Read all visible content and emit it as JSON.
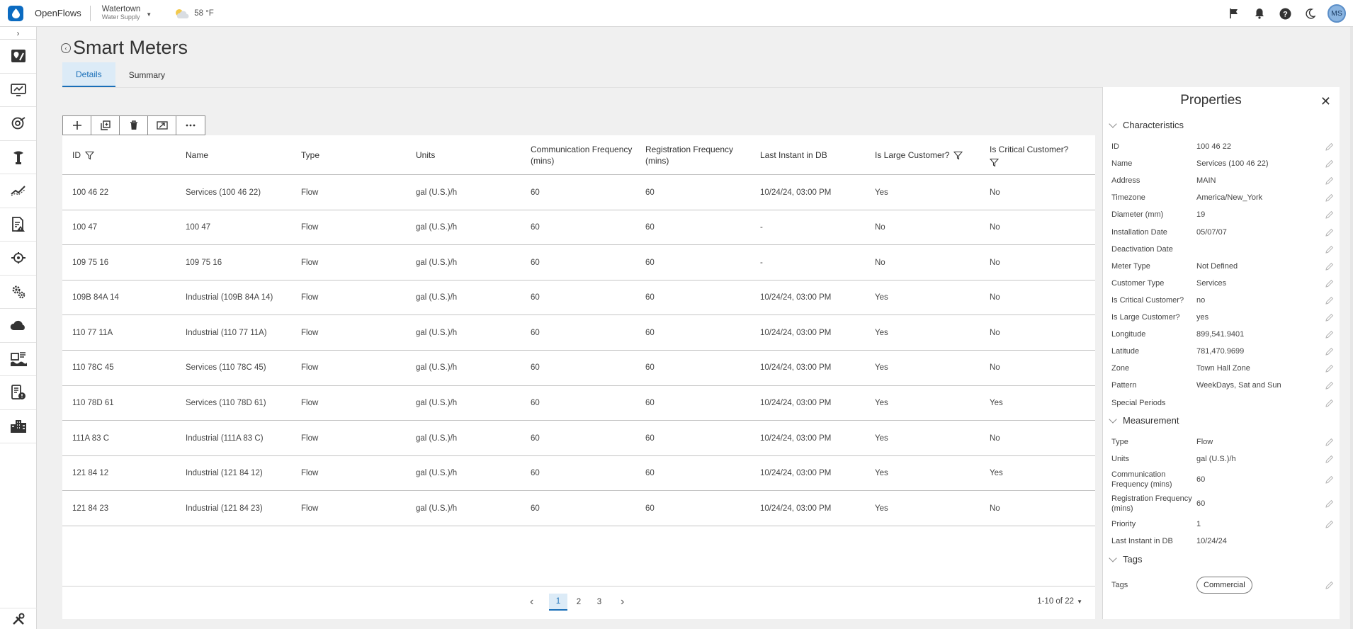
{
  "topbar": {
    "app_name": "OpenFlows",
    "location": "Watertown",
    "location_sub": "Water Supply",
    "weather": "58 °F",
    "user_initials": "MS"
  },
  "page": {
    "title": "Smart Meters",
    "tabs": [
      {
        "label": "Details",
        "active": true
      },
      {
        "label": "Summary",
        "active": false
      }
    ]
  },
  "table": {
    "columns": [
      {
        "label": "ID",
        "filter": true
      },
      {
        "label": "Name",
        "filter": false
      },
      {
        "label": "Type",
        "filter": false
      },
      {
        "label": "Units",
        "filter": false
      },
      {
        "label": "Communication Frequency (mins)",
        "filter": false
      },
      {
        "label": "Registration Frequency (mins)",
        "filter": false
      },
      {
        "label": "Last Instant in DB",
        "filter": false
      },
      {
        "label": "Is Large Customer?",
        "filter": true
      },
      {
        "label": "Is Critical Customer?",
        "filter": true
      }
    ],
    "rows": [
      [
        "100 46 22",
        "Services (100 46 22)",
        "Flow",
        "gal (U.S.)/h",
        "60",
        "60",
        "10/24/24, 03:00 PM",
        "Yes",
        "No"
      ],
      [
        "100 47",
        "100 47",
        "Flow",
        "gal (U.S.)/h",
        "60",
        "60",
        "-",
        "No",
        "No"
      ],
      [
        "109 75 16",
        "109 75 16",
        "Flow",
        "gal (U.S.)/h",
        "60",
        "60",
        "-",
        "No",
        "No"
      ],
      [
        "109B 84A 14",
        "Industrial (109B 84A 14)",
        "Flow",
        "gal (U.S.)/h",
        "60",
        "60",
        "10/24/24, 03:00 PM",
        "Yes",
        "No"
      ],
      [
        "110 77 11A",
        "Industrial (110 77 11A)",
        "Flow",
        "gal (U.S.)/h",
        "60",
        "60",
        "10/24/24, 03:00 PM",
        "Yes",
        "No"
      ],
      [
        "110 78C 45",
        "Services (110 78C 45)",
        "Flow",
        "gal (U.S.)/h",
        "60",
        "60",
        "10/24/24, 03:00 PM",
        "Yes",
        "No"
      ],
      [
        "110 78D 61",
        "Services (110 78D 61)",
        "Flow",
        "gal (U.S.)/h",
        "60",
        "60",
        "10/24/24, 03:00 PM",
        "Yes",
        "Yes"
      ],
      [
        "111A 83 C",
        "Industrial (111A 83 C)",
        "Flow",
        "gal (U.S.)/h",
        "60",
        "60",
        "10/24/24, 03:00 PM",
        "Yes",
        "No"
      ],
      [
        "121 84 12",
        "Industrial (121 84 12)",
        "Flow",
        "gal (U.S.)/h",
        "60",
        "60",
        "10/24/24, 03:00 PM",
        "Yes",
        "Yes"
      ],
      [
        "121 84 23",
        "Industrial (121 84 23)",
        "Flow",
        "gal (U.S.)/h",
        "60",
        "60",
        "10/24/24, 03:00 PM",
        "Yes",
        "No"
      ]
    ]
  },
  "pager": {
    "pages": [
      "1",
      "2",
      "3"
    ],
    "current": "1",
    "range": "1-10 of 22"
  },
  "properties": {
    "title": "Properties",
    "characteristics": {
      "title": "Characteristics",
      "fields": [
        {
          "label": "ID",
          "value": "100 46 22"
        },
        {
          "label": "Name",
          "value": "Services (100 46 22)"
        },
        {
          "label": "Address",
          "value": "MAIN"
        },
        {
          "label": "Timezone",
          "value": "America/New_York"
        },
        {
          "label": "Diameter (mm)",
          "value": "19"
        },
        {
          "label": "Installation Date",
          "value": "05/07/07"
        },
        {
          "label": "Deactivation Date",
          "value": ""
        },
        {
          "label": "Meter Type",
          "value": "Not Defined"
        },
        {
          "label": "Customer Type",
          "value": "Services"
        },
        {
          "label": "Is Critical Customer?",
          "value": "no"
        },
        {
          "label": "Is Large Customer?",
          "value": "yes"
        },
        {
          "label": "Longitude",
          "value": "899,541.9401"
        },
        {
          "label": "Latitude",
          "value": "781,470.9699"
        },
        {
          "label": "Zone",
          "value": "Town Hall Zone"
        },
        {
          "label": "Pattern",
          "value": "WeekDays, Sat and Sun"
        },
        {
          "label": "Special Periods",
          "value": ""
        }
      ]
    },
    "measurement": {
      "title": "Measurement",
      "fields": [
        {
          "label": "Type",
          "value": "Flow"
        },
        {
          "label": "Units",
          "value": "gal (U.S.)/h"
        },
        {
          "label": "Communication Frequency (mins)",
          "value": "60"
        },
        {
          "label": "Registration Frequency (mins)",
          "value": "60"
        },
        {
          "label": "Priority",
          "value": "1"
        },
        {
          "label": "Last Instant in DB",
          "value": "10/24/24"
        }
      ]
    },
    "tags": {
      "title": "Tags",
      "label": "Tags",
      "value": "Commercial"
    }
  },
  "icons": {
    "nav": [
      "map-pin-icon",
      "monitor-icon",
      "target-icon",
      "hydrant-icon",
      "trend-icon",
      "report-alert-icon",
      "pump-icon",
      "gears-icon",
      "cloud-icon",
      "flood-icon",
      "device-alert-icon",
      "building-icon",
      "tools-icon"
    ]
  }
}
